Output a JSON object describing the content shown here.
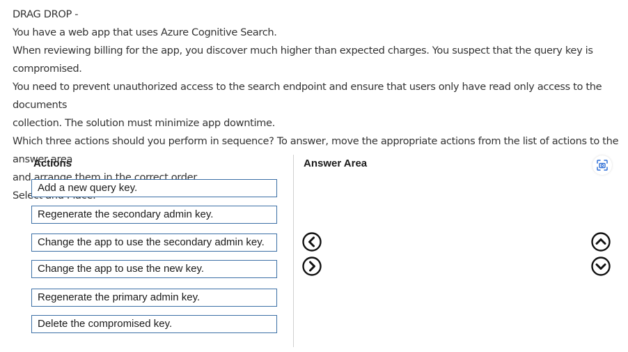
{
  "question": {
    "lines": [
      "DRAG DROP -",
      "You have a web app that uses Azure Cognitive Search.",
      "When reviewing billing for the app, you discover much higher than expected charges. You suspect that the query key is compromised.",
      "You need to prevent unauthorized access to the search endpoint and ensure that users only have read only access to the documents",
      "collection. The solution must minimize app downtime.",
      "Which three actions should you perform in sequence? To answer, move the appropriate actions from the list of actions to the answer area",
      "and arrange them in the correct order.",
      "Select and Place:"
    ]
  },
  "actions": {
    "header": "Actions",
    "items": [
      "Add a new query key.",
      "Regenerate the secondary admin key.",
      "Change the app to use the secondary admin key.",
      "Change the app to use the new key.",
      "Regenerate the primary admin key.",
      "Delete the compromised key."
    ]
  },
  "answer_area": {
    "header": "Answer Area"
  },
  "icons": {
    "move_left": "chevron-left-circle-icon",
    "move_right": "chevron-right-circle-icon",
    "move_up": "chevron-up-circle-icon",
    "move_down": "chevron-down-circle-icon",
    "screenshot": "camera-scan-icon"
  },
  "colors": {
    "item_border": "#3a6ea5",
    "arrow": "#111111",
    "screenshot_icon": "#2f6fd6"
  }
}
